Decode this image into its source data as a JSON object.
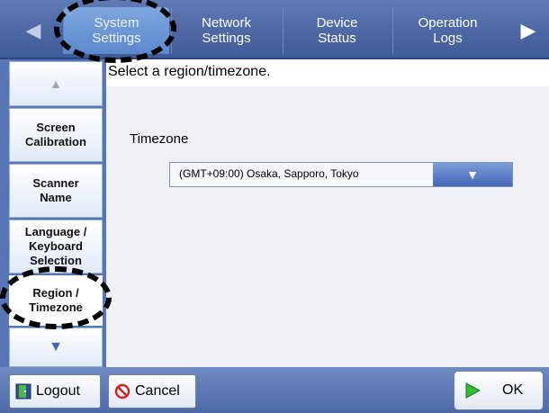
{
  "top_tabs": {
    "items": [
      {
        "label": "System\nSettings",
        "active": true
      },
      {
        "label": "Network\nSettings",
        "active": false
      },
      {
        "label": "Device\nStatus",
        "active": false
      },
      {
        "label": "Operation\nLogs",
        "active": false
      }
    ]
  },
  "sidebar": {
    "items": [
      {
        "label": "Screen\nCalibration"
      },
      {
        "label": "Scanner\nName"
      },
      {
        "label": "Language /\nKeyboard\nSelection"
      },
      {
        "label": "Region /\nTimezone",
        "selected": true
      }
    ]
  },
  "main": {
    "instruction": "Select a region/timezone.",
    "timezone_label": "Timezone",
    "timezone_value": "(GMT+09:00) Osaka, Sapporo, Tokyo"
  },
  "footer": {
    "logout_label": "Logout",
    "cancel_label": "Cancel",
    "ok_label": "OK"
  },
  "icons": {
    "scroll_up": "triangle-up-icon",
    "scroll_down": "triangle-down-icon",
    "dropdown": "triangle-down-icon",
    "logout": "door-icon",
    "cancel": "prohibited-icon",
    "ok": "play-icon"
  },
  "colors": {
    "tab_bar": "#4a66a6",
    "active_tab": "#6e98d8",
    "sidebar": "#5776b5",
    "dropdown_button": "#4167b7",
    "cancel_icon": "#d42020",
    "ok_icon": "#33b833"
  }
}
